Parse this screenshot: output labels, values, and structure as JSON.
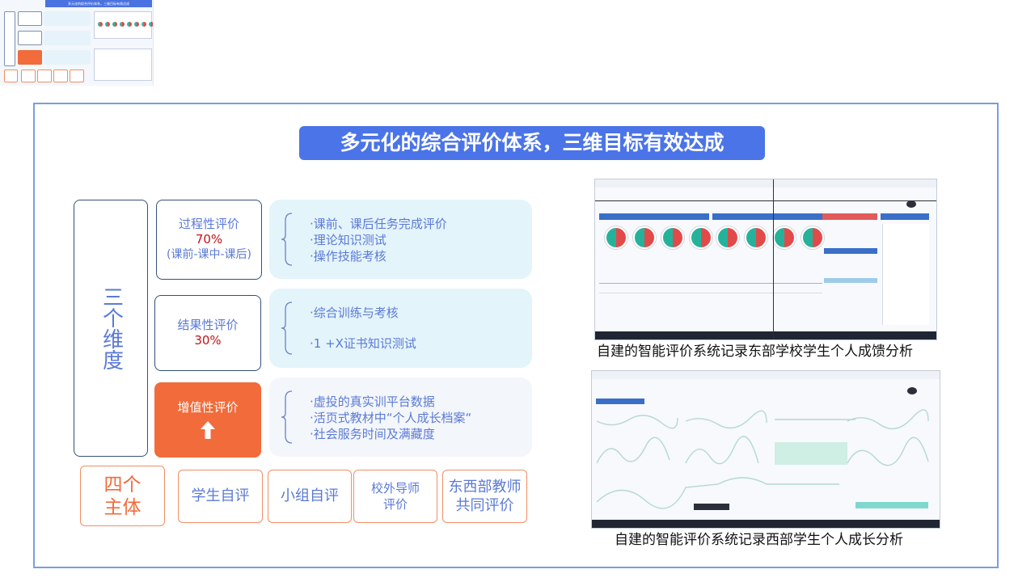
{
  "title": "多元化的综合评价体系，三维目标有效达成",
  "dimensions_label": "三个维度",
  "evaluations": {
    "process": {
      "name": "过程性评价",
      "percent": "70%",
      "sub": "(课前-课中-课后)"
    },
    "result": {
      "name": "结果性评价",
      "percent": "30%"
    },
    "value_added": {
      "name": "增值性评价",
      "icon": "up-arrow-icon"
    }
  },
  "details": {
    "process": [
      "·课前、课后任务完成评价",
      "·理论知识测试",
      "·操作技能考核"
    ],
    "result": [
      "·综合训练与考核",
      "·1 +X证书知识测试"
    ],
    "value_added": [
      "·虚投的真实训平台数据",
      "·活页式教材中“个人成长档案“",
      "·社会服务时间及满藏度"
    ]
  },
  "subjects": {
    "main_label": "四个主体",
    "items": [
      "学生自评",
      "小组自评",
      "校外导师评价",
      "东西部教师共同评价"
    ]
  },
  "screenshots": {
    "east_caption": "自建的智能评价系统记录东部学校学生个人成馈分析",
    "west_caption": "自建的智能评价系统记录西部学生个人成长分析"
  },
  "colors": {
    "accent_blue": "#4b74e8",
    "orange": "#f26b3a",
    "text_blue": "#5b7ad6",
    "percent_red": "#c0131a",
    "frame_border": "#7a9ede",
    "detail_bg": "#e4f4fb"
  }
}
